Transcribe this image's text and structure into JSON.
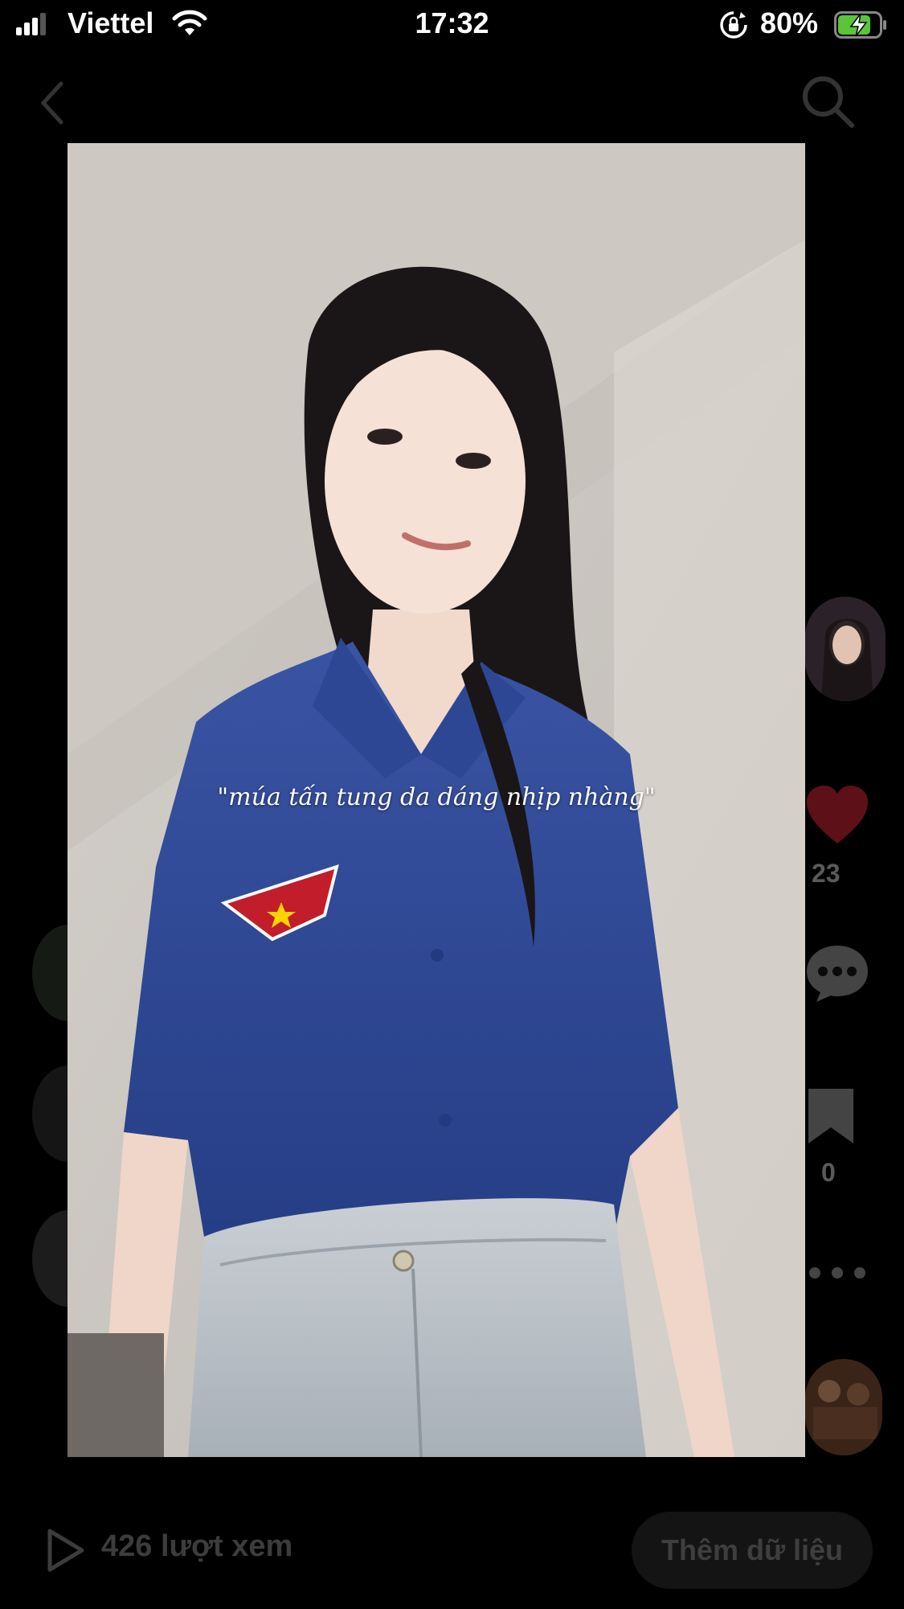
{
  "status_bar": {
    "carrier": "Viettel",
    "time": "17:32",
    "battery_percent": "80%",
    "battery_level": 0.8,
    "icons": [
      "signal-icon",
      "wifi-icon",
      "rotation-lock-icon",
      "battery-charging-icon"
    ]
  },
  "nav": {
    "back_icon": "chevron-left-icon",
    "search_icon": "search-icon"
  },
  "video": {
    "caption": "\"múa tấn tung da dáng nhịp nhàng\""
  },
  "actions": {
    "like_count": "23",
    "save_count": "0",
    "icons": [
      "avatar",
      "heart-icon",
      "comment-icon",
      "bookmark-icon",
      "more-icon",
      "music-disc"
    ]
  },
  "footer": {
    "views": "426 lượt xem",
    "add_data_label": "Thêm dữ liệu"
  },
  "colors": {
    "background": "#000000",
    "like_red": "#c8102e",
    "battery_green": "#5ac43a"
  }
}
